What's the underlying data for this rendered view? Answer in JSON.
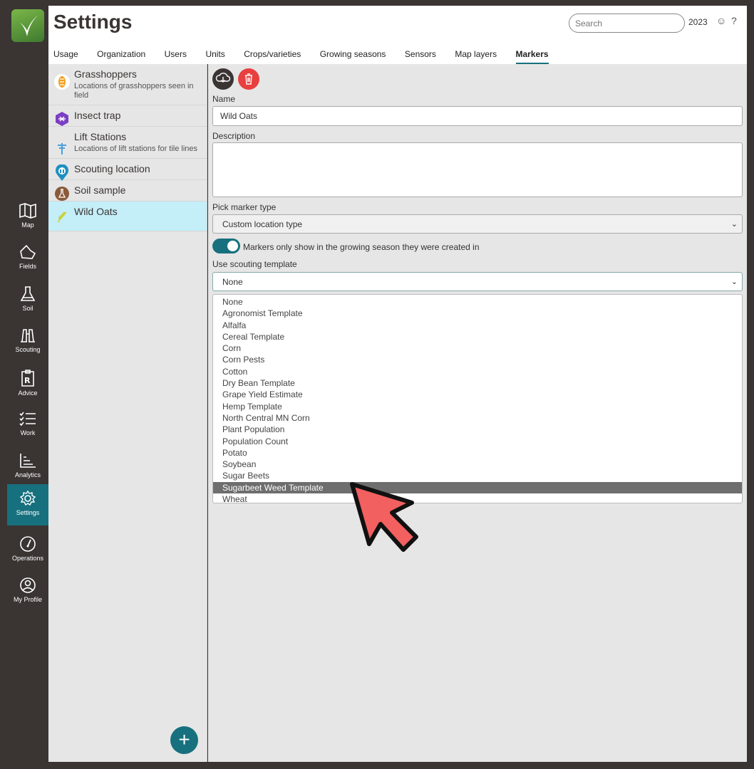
{
  "app": {
    "title": "Settings"
  },
  "header": {
    "search_placeholder": "Search",
    "year": "2023",
    "feedback_glyph": "☺",
    "help_glyph": "?"
  },
  "tabs": [
    {
      "label": "Usage"
    },
    {
      "label": "Organization"
    },
    {
      "label": "Users"
    },
    {
      "label": "Units"
    },
    {
      "label": "Crops/varieties"
    },
    {
      "label": "Growing seasons"
    },
    {
      "label": "Sensors"
    },
    {
      "label": "Map layers"
    },
    {
      "label": "Markers"
    }
  ],
  "active_tab": "Markers",
  "nav": [
    {
      "label": "Map",
      "icon": "map-icon"
    },
    {
      "label": "Fields",
      "icon": "fields-icon"
    },
    {
      "label": "Soil",
      "icon": "flask-icon"
    },
    {
      "label": "Scouting",
      "icon": "binoculars-icon"
    },
    {
      "label": "Advice",
      "icon": "prescription-icon"
    },
    {
      "label": "Work",
      "icon": "checklist-icon"
    },
    {
      "label": "Analytics",
      "icon": "chart-icon"
    },
    {
      "label": "Settings",
      "icon": "gear-icon"
    },
    {
      "label": "Operations",
      "icon": "gauge-icon"
    },
    {
      "label": "My Profile",
      "icon": "user-icon"
    }
  ],
  "active_nav": "Settings",
  "markers": [
    {
      "name": "Grasshoppers",
      "description": "Locations of grasshoppers seen in field",
      "icon": "grasshopper-icon",
      "color": "#f0a020"
    },
    {
      "name": "Insect trap",
      "description": "",
      "icon": "insect-trap-icon",
      "color": "#7b3fc4"
    },
    {
      "name": "Lift Stations",
      "description": "Locations of lift stations for tile lines",
      "icon": "lift-station-icon",
      "color": "#4aa0d8"
    },
    {
      "name": "Scouting location",
      "description": "",
      "icon": "scouting-location-icon",
      "color": "#1f8fc0"
    },
    {
      "name": "Soil sample",
      "description": "",
      "icon": "soil-sample-icon",
      "color": "#8a5a3a"
    },
    {
      "name": "Wild Oats",
      "description": "",
      "icon": "wild-oats-icon",
      "color": "#c8d23a"
    }
  ],
  "selected_marker": "Wild Oats",
  "form": {
    "name_label": "Name",
    "name_value": "Wild Oats",
    "description_label": "Description",
    "description_value": "",
    "marker_type_label": "Pick marker type",
    "marker_type_value": "Custom location type",
    "toggle_label": "Markers only show in the growing season they were created in",
    "toggle_on": true,
    "template_label": "Use scouting template",
    "template_value": "None"
  },
  "template_options": [
    "None",
    "Agronomist Template",
    "Alfalfa",
    "Cereal Template",
    "Corn",
    "Corn Pests",
    "Cotton",
    "Dry Bean Template",
    "Grape Yield Estimate",
    "Hemp Template",
    "North Central MN Corn",
    "Plant Population",
    "Population Count",
    "Potato",
    "Soybean",
    "Sugar Beets",
    "Sugarbeet Weed Template",
    "Wheat"
  ],
  "highlighted_option": "Sugarbeet Weed Template",
  "colors": {
    "accent": "#17707e",
    "delete": "#e8403f",
    "cursor": "#f26060"
  }
}
